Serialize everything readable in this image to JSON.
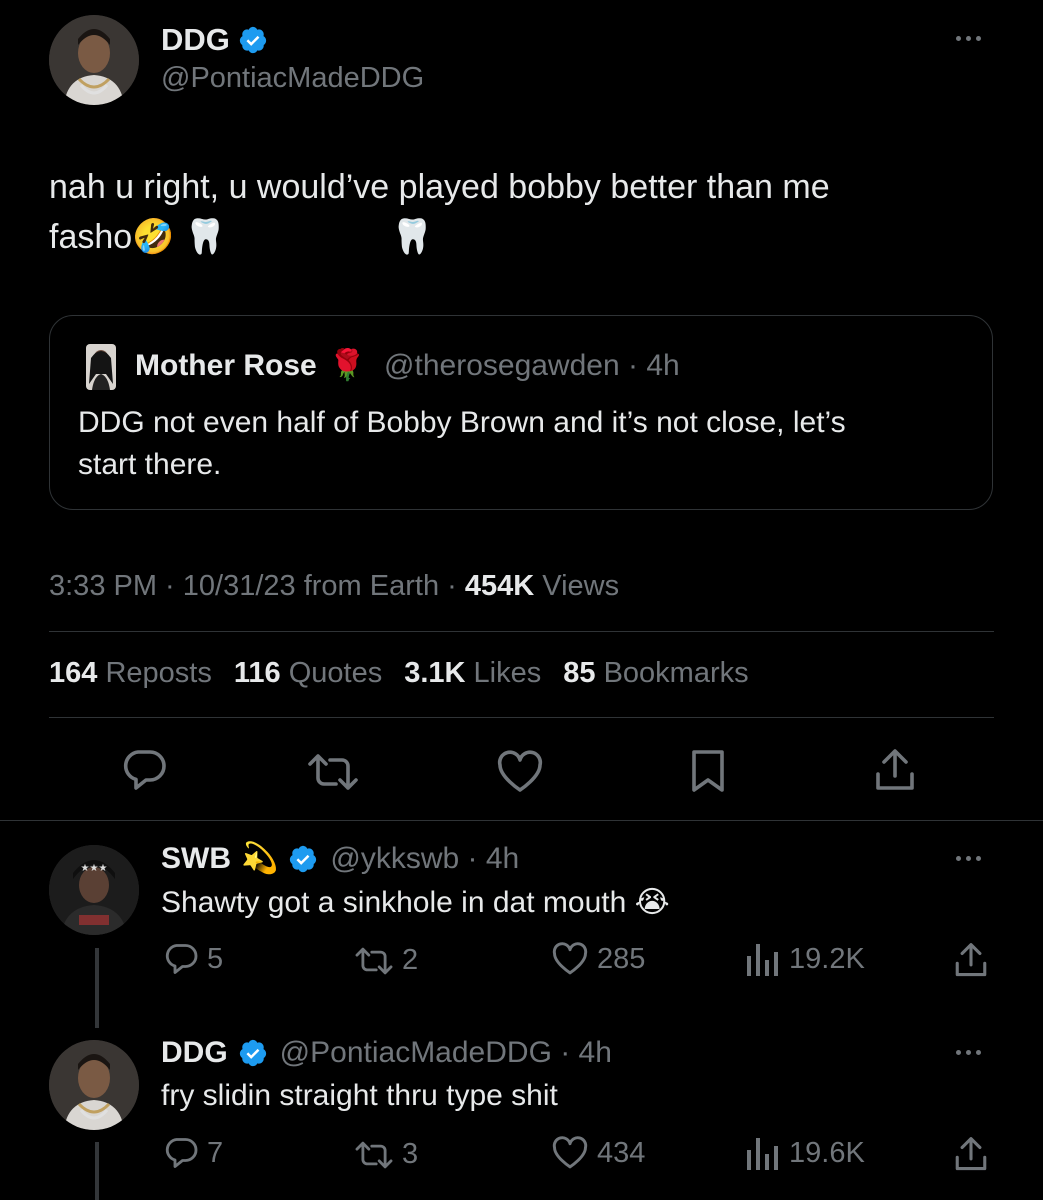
{
  "main_tweet": {
    "display_name": "DDG",
    "handle": "@PontiacMadeDDG",
    "text_line1": "nah u right, u would’ve played bobby better than me",
    "text_line2": "fasho🤣 🦷",
    "text_trailing_emoji": "🦷",
    "quote": {
      "display_name": "Mother Rose",
      "name_emoji": "🌹",
      "handle_time": "@therosegawden · 4h",
      "text_line1": "DDG not even half of Bobby Brown and it’s not close, let’s",
      "text_line2": "start there."
    },
    "meta_time": "3:33 PM · 10/31/23 from Earth · ",
    "meta_views_count": "454K",
    "meta_views_label": " Views",
    "stats": [
      {
        "count": "164",
        "label": "Reposts"
      },
      {
        "count": "116",
        "label": "Quotes"
      },
      {
        "count": "3.1K",
        "label": "Likes"
      },
      {
        "count": "85",
        "label": "Bookmarks"
      }
    ]
  },
  "replies": [
    {
      "display_name": "SWB",
      "name_emoji": "💫",
      "handle_time": "@ykkswb · 4h",
      "text": "Shawty got a sinkhole in dat mouth 😭",
      "replies": "5",
      "reposts": "2",
      "likes": "285",
      "views": "19.2K"
    },
    {
      "display_name": "DDG",
      "handle_time": "@PontiacMadeDDG · 4h",
      "text": "fry slidin straight thru type shit",
      "replies": "7",
      "reposts": "3",
      "likes": "434",
      "views": "19.6K"
    }
  ],
  "colors": {
    "background": "#000000",
    "text": "#e7e9ea",
    "secondary": "#71767b",
    "verified": "#1d9bf0",
    "divider": "#2f3336"
  }
}
